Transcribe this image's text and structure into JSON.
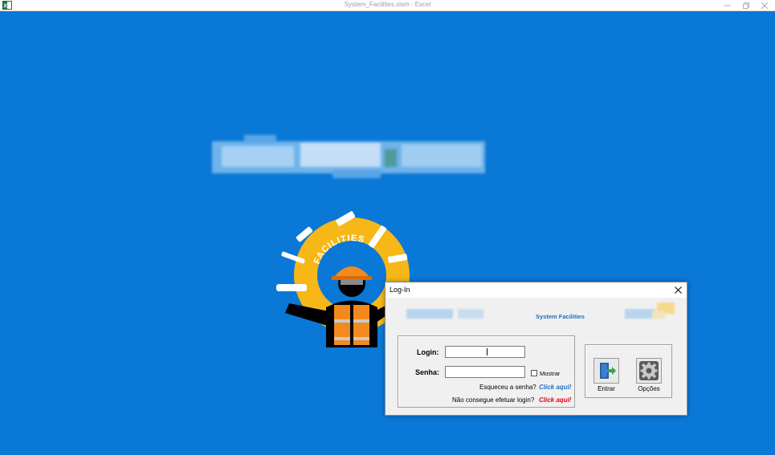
{
  "window": {
    "title": "System_Facilities.xlsm - Excel"
  },
  "logo": {
    "ring_text": "FACILITIES",
    "ring_color": "#f7b717"
  },
  "dialog": {
    "title": "Log-In",
    "system_label": "System Facilities",
    "login_label": "Login:",
    "login_value": "",
    "password_label": "Senha:",
    "password_value": "",
    "show_label": "Mostrar",
    "show_checked": false,
    "forgot_text": "Esqueceu a senha?",
    "forgot_link": "Click aqui!",
    "cant_login_text": "Não consegue efetuar login?",
    "cant_login_link": "Click aqui!",
    "enter_button": "Entrar",
    "options_button": "Opções"
  },
  "colors": {
    "background": "#0a78d7",
    "link_blue": "#1f6fbf",
    "link_red": "#e0001b"
  }
}
